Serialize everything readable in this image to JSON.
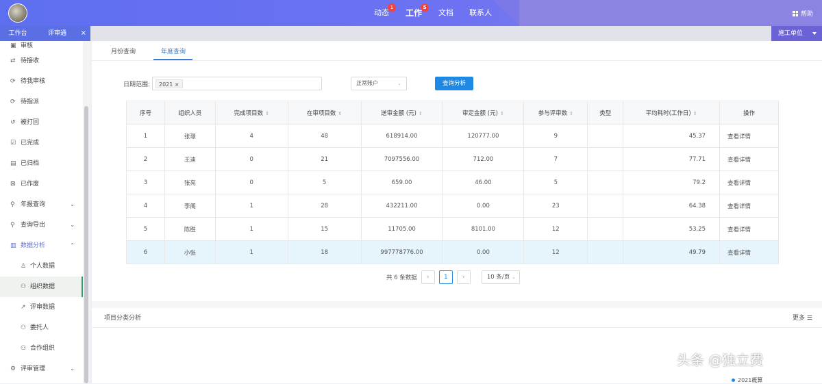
{
  "header": {
    "nav": [
      {
        "label": "动态",
        "badge": "1"
      },
      {
        "label": "工作",
        "badge": "5"
      },
      {
        "label": "文档",
        "badge": ""
      },
      {
        "label": "联系人",
        "badge": ""
      }
    ],
    "help_label": "帮助"
  },
  "tabs": {
    "home_label": "工作台",
    "review_label": "评审通",
    "close_glyph": "×",
    "unit_label": "施工单位"
  },
  "sidebar": {
    "items": [
      {
        "label": "审核",
        "icon": "doc-icon"
      },
      {
        "label": "待接收",
        "icon": "swap-icon"
      },
      {
        "label": "待我审核",
        "icon": "refresh-icon"
      },
      {
        "label": "待指派",
        "icon": "refresh-icon"
      },
      {
        "label": "被打回",
        "icon": "return-icon"
      },
      {
        "label": "已完成",
        "icon": "check-icon"
      },
      {
        "label": "已归档",
        "icon": "archive-icon"
      },
      {
        "label": "已作废",
        "icon": "void-icon"
      },
      {
        "label": "年报查询",
        "icon": "search-icon"
      },
      {
        "label": "查询导出",
        "icon": "search-icon"
      },
      {
        "label": "数据分析",
        "icon": "chart-icon"
      },
      {
        "label": "个人数据",
        "icon": "user-icon"
      },
      {
        "label": "组织数据",
        "icon": "group-icon"
      },
      {
        "label": "评审数据",
        "icon": "line-chart-icon"
      },
      {
        "label": "委托人",
        "icon": "group-icon"
      },
      {
        "label": "合作组织",
        "icon": "group-icon"
      },
      {
        "label": "评审管理",
        "icon": "settings-icon"
      }
    ]
  },
  "subtabs": {
    "monthly": "月份查询",
    "yearly": "年度查询"
  },
  "filter": {
    "date_label": "日期范围:",
    "date_tag": "2021",
    "account_select": "正常账户",
    "query_button": "查询分析"
  },
  "table": {
    "headers": [
      "序号",
      "组织人员",
      "完成项目数",
      "在审项目数",
      "送审金额 (元)",
      "审定金额 (元)",
      "参与评审数",
      "类型",
      "平均耗时(工作日)",
      "操作"
    ],
    "rows": [
      [
        "1",
        "张璟",
        "4",
        "48",
        "618914.00",
        "120777.00",
        "9",
        "",
        "45.37",
        "查看详情"
      ],
      [
        "2",
        "王迪",
        "0",
        "21",
        "7097556.00",
        "712.00",
        "7",
        "",
        "77.71",
        "查看详情"
      ],
      [
        "3",
        "张亮",
        "0",
        "5",
        "659.00",
        "46.00",
        "5",
        "",
        "79.2",
        "查看详情"
      ],
      [
        "4",
        "李阁",
        "1",
        "28",
        "432211.00",
        "0.00",
        "23",
        "",
        "64.38",
        "查看详情"
      ],
      [
        "5",
        "陈胜",
        "1",
        "15",
        "11705.00",
        "8101.00",
        "12",
        "",
        "53.25",
        "查看详情"
      ],
      [
        "6",
        "小张",
        "1",
        "18",
        "997778776.00",
        "0.00",
        "12",
        "",
        "49.79",
        "查看详情"
      ]
    ]
  },
  "pager": {
    "total": "共 6 条数据",
    "current": "1",
    "page_size": "10 条/页"
  },
  "section": {
    "title": "项目分类分析",
    "more": "更多"
  },
  "legend": {
    "label": "2021概算"
  },
  "watermark": "头条 @独立费",
  "colors": {
    "accent": "#5b6fe4",
    "primary_button": "#1e88e5",
    "badge": "#f5413c",
    "highlight_row": "#e6f4fb"
  }
}
